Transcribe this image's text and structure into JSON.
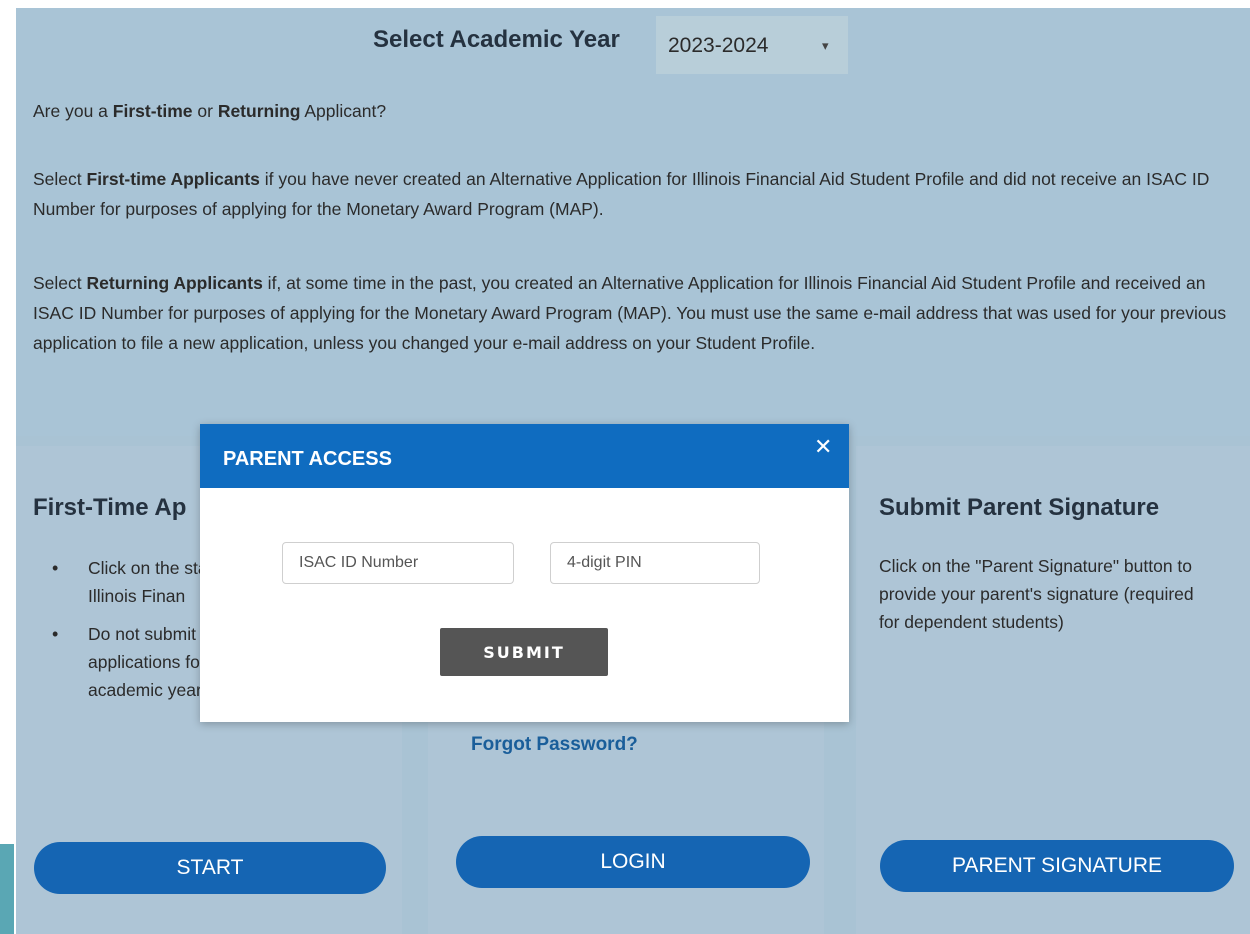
{
  "year_select": {
    "label": "Select Academic Year",
    "value": "2023-2024",
    "caret_icon": "▾"
  },
  "intro": {
    "question": {
      "pre": "Are you a ",
      "b1": "First-time",
      "mid": " or ",
      "b2": "Returning",
      "post": " Applicant?"
    },
    "first_time": {
      "pre": "Select ",
      "bold": "First-time Applicants",
      "rest": " if you have never created an Alternative Application for Illinois Financial Aid Student Profile and did not receive an ISAC ID Number for purposes of applying for the Monetary Award Program (MAP)."
    },
    "returning": {
      "pre": "Select ",
      "bold": "Returning Applicants",
      "rest": " if, at some time in the past, you created an Alternative Application for Illinois Financial Aid Student Profile and received an ISAC ID Number for purposes of applying for the Monetary Award Program (MAP).  You must use the same e-mail address that was used for your previous application to file a new application, unless you changed your e-mail address on your Student Profile."
    }
  },
  "cards": {
    "first_time": {
      "title": "First-Time Ap",
      "bullets": [
        "Click on the start a new Alternative Illinois Finan",
        "Do not submit multiple applications for the same academic year"
      ],
      "button": "START"
    },
    "returning": {
      "forgot": "Forgot Password?",
      "button": "LOGIN"
    },
    "parent": {
      "title": "Submit Parent Signature",
      "text": "Click on the \"Parent Signature\" button to provide your parent's signature (required for dependent students)",
      "button": "PARENT SIGNATURE"
    }
  },
  "modal": {
    "title": "PARENT ACCESS",
    "close_icon": "✕",
    "isac_placeholder": "ISAC ID Number",
    "pin_placeholder": "4-digit PIN",
    "submit": "SUBMIT"
  },
  "colors": {
    "modal_header": "#0f6cc0",
    "pill_button": "#1565b3",
    "submit_button": "#555555",
    "background": "#a9c4d6"
  }
}
